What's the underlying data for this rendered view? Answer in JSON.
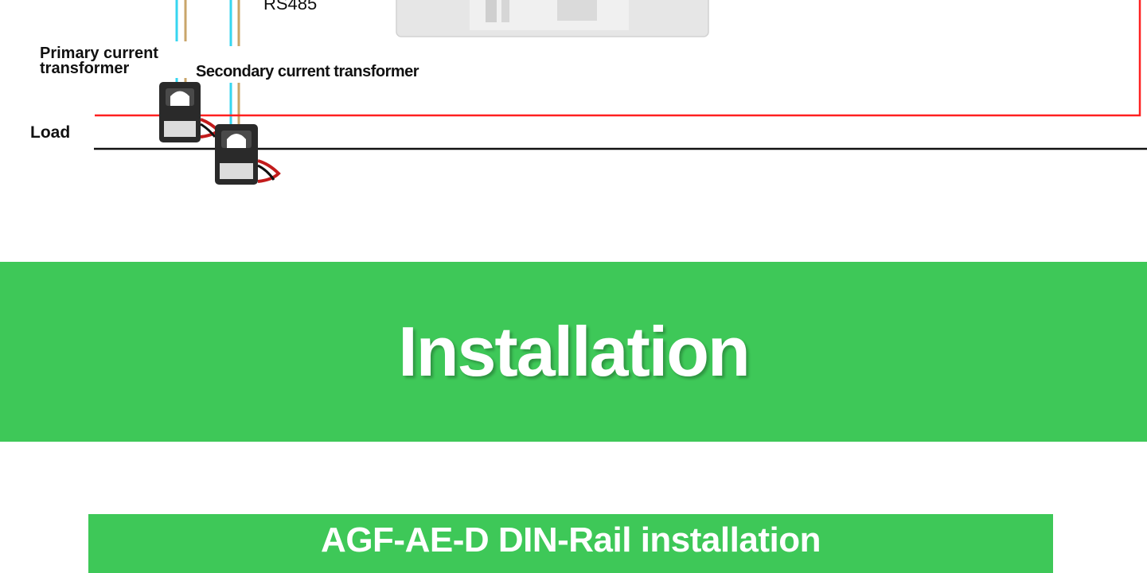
{
  "diagram": {
    "labels": {
      "rs485": "RS485",
      "primary_ct": "Primary current transformer",
      "secondary_ct": "Secondary current transformer",
      "load": "Load"
    }
  },
  "sections": {
    "main_title": "Installation",
    "sub_title": "AGF-AE-D DIN-Rail installation"
  },
  "colors": {
    "banner_green": "#3ec858",
    "live_wire": "#ff2020",
    "neutral_wire": "#111111",
    "rs485_cyan": "#36d6f0",
    "rs485_tan": "#c9a56a"
  }
}
